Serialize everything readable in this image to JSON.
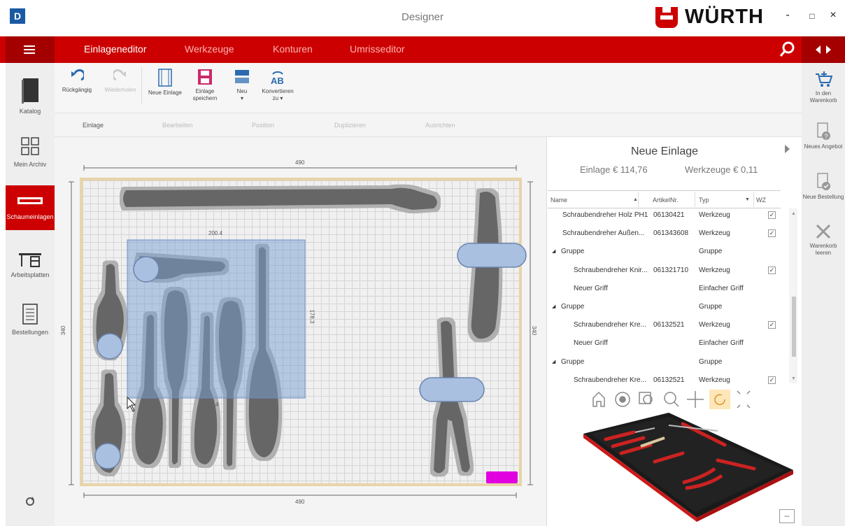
{
  "app": {
    "logo_letter": "D",
    "title": "Designer",
    "brand": "WÜRTH",
    "win_min": "-",
    "win_max": "□",
    "win_close": "×"
  },
  "menu": {
    "tabs": [
      "Einlageneditor",
      "Werkzeuge",
      "Konturen",
      "Umrisseditor"
    ]
  },
  "sidebar": {
    "items": [
      {
        "label": "Katalog"
      },
      {
        "label": "Mein Archiv"
      },
      {
        "label": "Schaumeinlagen"
      },
      {
        "label": "Arbeitsplatten"
      },
      {
        "label": "Bestellungen"
      }
    ]
  },
  "rightbar": {
    "items": [
      {
        "label": "In den Warenkorb"
      },
      {
        "label": "Neues Angebot"
      },
      {
        "label": "Neue Bestellung"
      },
      {
        "label": "Warenkorb leeren"
      }
    ]
  },
  "toolbar": {
    "undo": "Rückgängig",
    "redo": "Wiederholen",
    "new_insert": "Neue Einlage",
    "save_insert": "Einlage speichern",
    "new": "Neu",
    "convert": "Konvertieren zu"
  },
  "subtabs": [
    "Einlage",
    "Bearbeiten",
    "Position",
    "Duplizieren",
    "Ausrichten"
  ],
  "canvas": {
    "dim_top": "490",
    "dim_bottom": "490",
    "dim_left": "340",
    "dim_right": "340",
    "sel_width": "200.4",
    "sel_height": "178.3",
    "sel_small": "4"
  },
  "panel": {
    "title": "Neue Einlage",
    "insert_price": "Einlage € 114,76",
    "tools_price": "Werkzeuge € 0,11",
    "columns": [
      "Name",
      "ArtikelNr.",
      "Typ",
      "WZ"
    ],
    "rows": [
      {
        "name": "Schraubendreher Holz PH1",
        "art": "06130421",
        "type": "Werkzeug",
        "wz": "✓",
        "indent": 1
      },
      {
        "name": "Schraubendreher Außen...",
        "art": "061343608",
        "type": "Werkzeug",
        "wz": "✓",
        "indent": 1
      },
      {
        "name": "Gruppe",
        "art": "",
        "type": "Gruppe",
        "wz": "",
        "indent": 0
      },
      {
        "name": "Schraubendreher Knir...",
        "art": "061321710",
        "type": "Werkzeug",
        "wz": "✓",
        "indent": 2
      },
      {
        "name": "Neuer Griff",
        "art": "",
        "type": "Einfacher Griff",
        "wz": "",
        "indent": 2
      },
      {
        "name": "Gruppe",
        "art": "",
        "type": "Gruppe",
        "wz": "",
        "indent": 0
      },
      {
        "name": "Schraubendreher Kre...",
        "art": "06132521",
        "type": "Werkzeug",
        "wz": "✓",
        "indent": 2
      },
      {
        "name": "Neuer Griff",
        "art": "",
        "type": "Einfacher Griff",
        "wz": "",
        "indent": 2
      },
      {
        "name": "Gruppe",
        "art": "",
        "type": "Gruppe",
        "wz": "",
        "indent": 0
      },
      {
        "name": "Schraubendreher Kre...",
        "art": "06132521",
        "type": "Werkzeug",
        "wz": "✓",
        "indent": 2
      }
    ]
  },
  "colors": {
    "brand_red": "#cc0000",
    "dark_red": "#a40000",
    "selection": "#7a9fd1"
  }
}
